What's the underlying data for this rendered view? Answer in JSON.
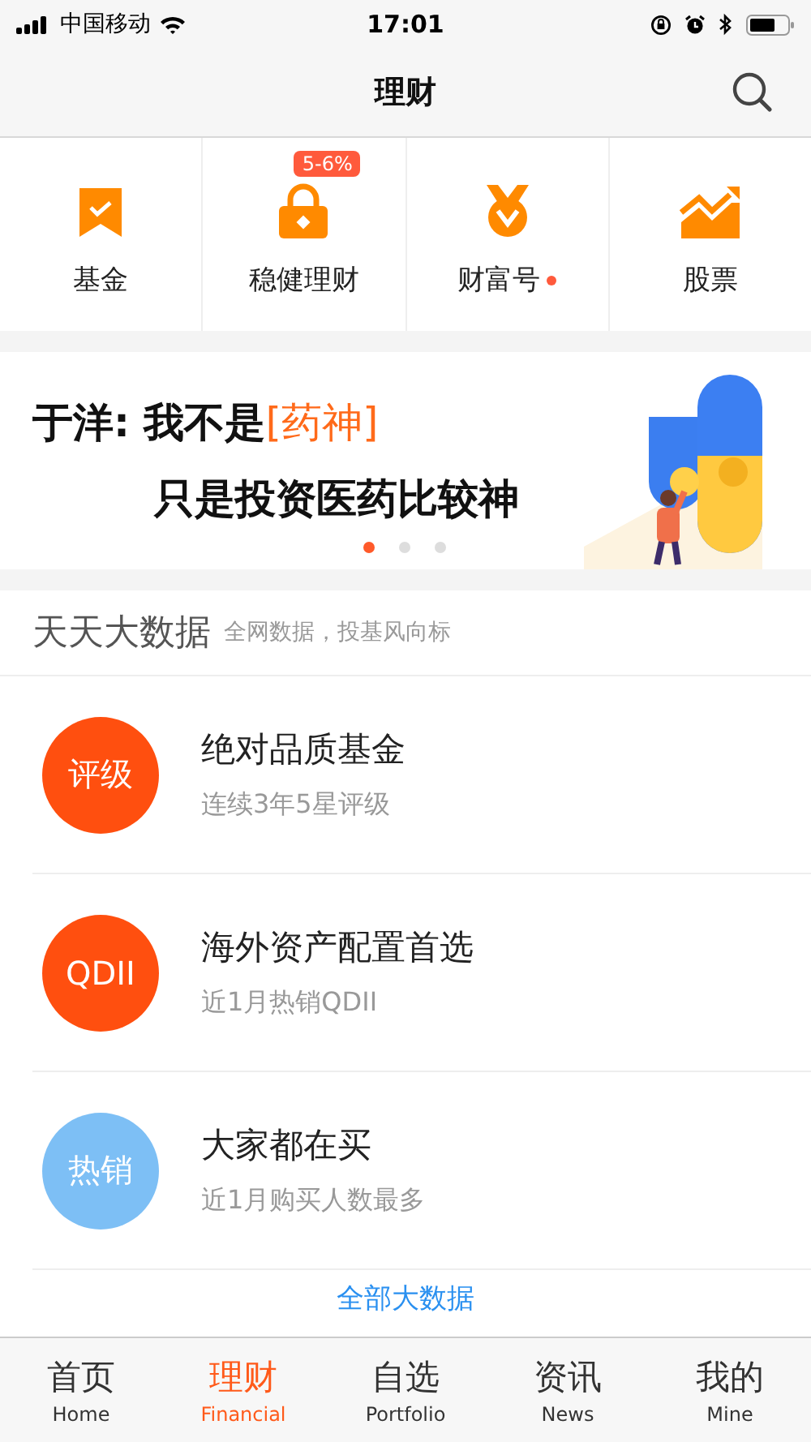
{
  "status_bar": {
    "carrier": "中国移动",
    "time": "17:01"
  },
  "nav_bar": {
    "title": "理财"
  },
  "quick_links": [
    {
      "label": "基金",
      "kind": "bookmark",
      "dot": false
    },
    {
      "label": "稳健理财",
      "kind": "lock",
      "badge": "5-6%",
      "dot": false
    },
    {
      "label": "财富号",
      "kind": "medal",
      "dot": true
    },
    {
      "label": "股票",
      "kind": "chart",
      "dot": false
    }
  ],
  "banner": {
    "line_1": [
      {
        "text": "于洋: 我不是",
        "highlight": false
      },
      {
        "text": "[药神]",
        "highlight": true
      }
    ],
    "line_2": "只是投资医药比较神",
    "dots": [
      {
        "selected": true
      },
      {
        "selected": false
      },
      {
        "selected": false
      }
    ]
  },
  "section": {
    "title": "天天大数据",
    "subtitle": "全网数据，投基风向标"
  },
  "rows": [
    {
      "badge": "评级",
      "color": "#ff4f0f",
      "title": "绝对品质基金",
      "subtitle": "连续3年5星评级"
    },
    {
      "badge": "QDII",
      "color": "#ff4f0f",
      "title": "海外资产配置首选",
      "subtitle": "近1月热销QDII"
    },
    {
      "badge": "热销",
      "color": "#7dbff5",
      "title": "大家都在买",
      "subtitle": "近1月购买人数最多"
    }
  ],
  "more_link": "全部大数据",
  "tabs": [
    {
      "label": "首页",
      "sublabel": "Home",
      "selected": false
    },
    {
      "label": "理财",
      "sublabel": "Financial",
      "selected": true
    },
    {
      "label": "自选",
      "sublabel": "Portfolio",
      "selected": false
    },
    {
      "label": "资讯",
      "sublabel": "News",
      "selected": false
    },
    {
      "label": "我的",
      "sublabel": "Mine",
      "selected": false
    }
  ]
}
